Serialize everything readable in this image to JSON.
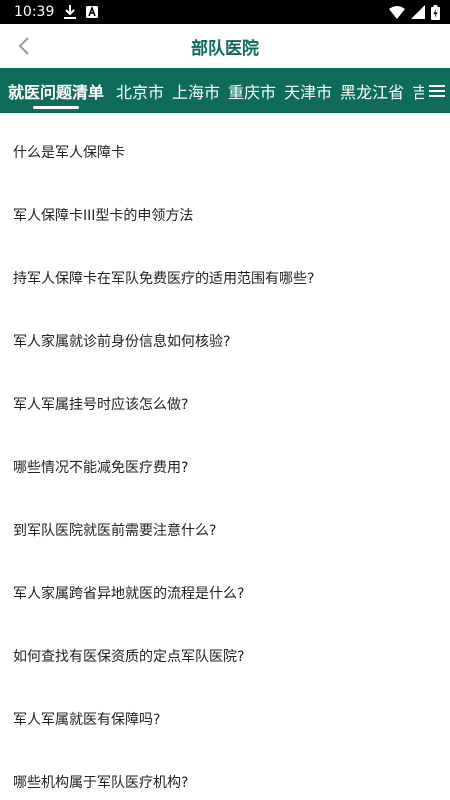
{
  "status_bar": {
    "time": "10:39",
    "left_icons": [
      "download-icon",
      "font-a-icon"
    ],
    "right_icons": [
      "wifi-icon",
      "signal-icon",
      "battery-icon"
    ]
  },
  "header": {
    "title": "部队医院",
    "title_color": "#0f6b5c"
  },
  "tabs": [
    {
      "label": "就医问题清单",
      "active": true
    },
    {
      "label": "北京市",
      "active": false
    },
    {
      "label": "上海市",
      "active": false
    },
    {
      "label": "重庆市",
      "active": false
    },
    {
      "label": "天津市",
      "active": false
    },
    {
      "label": "黑龙江省",
      "active": false
    },
    {
      "label": "吉",
      "active": false
    }
  ],
  "tab_bar_color": "#0f6b5c",
  "questions": [
    "什么是军人保障卡",
    "军人保障卡III型卡的申领方法",
    "持军人保障卡在军队免费医疗的适用范围有哪些?",
    "军人家属就诊前身份信息如何核验?",
    "军人军属挂号时应该怎么做?",
    "哪些情况不能减免医疗费用?",
    "到军队医院就医前需要注意什么?",
    "军人家属跨省异地就医的流程是什么?",
    "如何查找有医保资质的定点军队医院?",
    "军人军属就医有保障吗?",
    "哪些机构属于军队医疗机构?"
  ]
}
